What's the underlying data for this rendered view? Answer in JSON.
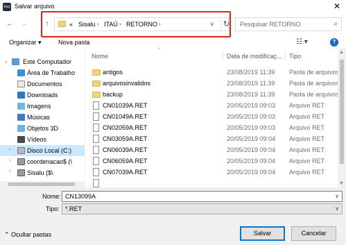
{
  "window": {
    "app_icon_text": "Itaú",
    "title": "Salvar arquivo",
    "close_glyph": "✕"
  },
  "nav": {
    "back_glyph": "←",
    "forward_glyph": "→",
    "up_glyph": "↑"
  },
  "address": {
    "prefix_glyph": "«",
    "crumbs": [
      "Sisalu",
      "ITAÚ",
      "RETORNO"
    ],
    "separator_glyph": "›",
    "dropdown_glyph": "∨",
    "refresh_glyph": "↻"
  },
  "search": {
    "placeholder": "Pesquisar RETORNO",
    "icon_glyph": "⌕"
  },
  "toolbar": {
    "organize": "Organizar ▾",
    "new_folder": "Nova pasta",
    "view_glyph": "☷ ▾",
    "help_glyph": "?"
  },
  "sidebar": {
    "items": [
      {
        "label": "Este Computador",
        "icon": "computer-icon"
      },
      {
        "label": "Área de Trabalho",
        "icon": "desktop-icon"
      },
      {
        "label": "Documentos",
        "icon": "documents-icon"
      },
      {
        "label": "Downloads",
        "icon": "downloads-icon"
      },
      {
        "label": "Imagens",
        "icon": "pictures-icon"
      },
      {
        "label": "Músicas",
        "icon": "music-icon"
      },
      {
        "label": "Objetos 3D",
        "icon": "objects-3d-icon"
      },
      {
        "label": "Vídeos",
        "icon": "videos-icon"
      },
      {
        "label": "Disco Local (C:)",
        "icon": "drive-icon",
        "selected": true
      },
      {
        "label": "coordenacao$ (\\",
        "icon": "network-drive-icon"
      },
      {
        "label": "Sisalu ($\\",
        "icon": "network-drive-icon"
      }
    ]
  },
  "columns": {
    "name": "Nome",
    "date": "Data de modificaç...",
    "type": "Tipo",
    "sort_glyph": "^"
  },
  "files": [
    {
      "name": "antigos",
      "date": "23/08/2019 11:39",
      "type": "Pasta de arquivos",
      "kind": "folder"
    },
    {
      "name": "arquivosinvalidos",
      "date": "23/08/2019 11:39",
      "type": "Pasta de arquivos",
      "kind": "folder"
    },
    {
      "name": "backup",
      "date": "23/08/2019 11:39",
      "type": "Pasta de arquivos",
      "kind": "folder"
    },
    {
      "name": "CN01039A.RET",
      "date": "20/05/2019 09:03",
      "type": "Arquivo RET",
      "kind": "file"
    },
    {
      "name": "CN01049A.RET",
      "date": "20/05/2019 09:03",
      "type": "Arquivo RET",
      "kind": "file"
    },
    {
      "name": "CN02059A.RET",
      "date": "20/05/2019 09:03",
      "type": "Arquivo RET",
      "kind": "file"
    },
    {
      "name": "CN03059A.RET",
      "date": "20/05/2019 09:04",
      "type": "Arquivo RET",
      "kind": "file"
    },
    {
      "name": "CN06039A.RET",
      "date": "20/05/2019 09:04",
      "type": "Arquivo RET",
      "kind": "file"
    },
    {
      "name": "CN06059A.RET",
      "date": "20/05/2019 09:04",
      "type": "Arquivo RET",
      "kind": "file"
    },
    {
      "name": "CN07039A.RET",
      "date": "20/05/2019 09:04",
      "type": "Arquivo RET",
      "kind": "file"
    },
    {
      "name": "",
      "date": "",
      "type": "",
      "kind": "file"
    }
  ],
  "form": {
    "name_label": "Nome:",
    "name_value": "CN13099A",
    "type_label": "Tipo:",
    "type_value": "*.RET",
    "dropdown_glyph": "∨"
  },
  "footer": {
    "hide_folders": "⌃  Ocultar pastas",
    "save": "Salvar",
    "cancel": "Cancelar"
  },
  "colors": {
    "highlight": "#e0211a",
    "selected": "#cce8ff",
    "accent": "#0078d7"
  }
}
